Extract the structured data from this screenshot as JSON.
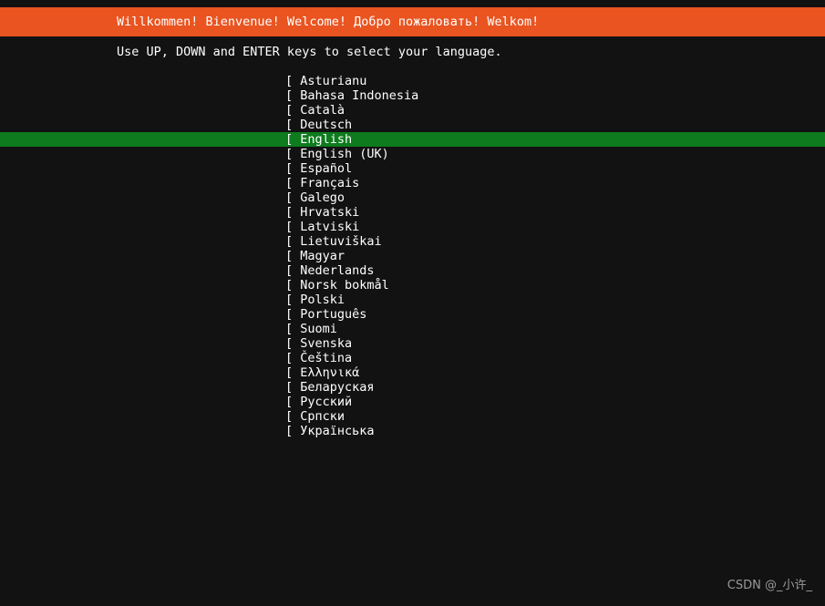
{
  "screen": {
    "background_color": "#121212",
    "accent_color": "#e95420",
    "highlight_color": "#0e7b1e",
    "text_color": "#ffffff"
  },
  "banner": {
    "text": "Willkommen! Bienvenue! Welcome! Добро пожаловать! Welkom!"
  },
  "instruction": {
    "text": "Use UP, DOWN and ENTER keys to select your language."
  },
  "language_list": {
    "bracket_prefix": "[ ",
    "selected_index": 4,
    "items": [
      {
        "label": "Asturianu",
        "selected": false
      },
      {
        "label": "Bahasa Indonesia",
        "selected": false
      },
      {
        "label": "Català",
        "selected": false
      },
      {
        "label": "Deutsch",
        "selected": false
      },
      {
        "label": "English",
        "selected": true
      },
      {
        "label": "English (UK)",
        "selected": false
      },
      {
        "label": "Español",
        "selected": false
      },
      {
        "label": "Français",
        "selected": false
      },
      {
        "label": "Galego",
        "selected": false
      },
      {
        "label": "Hrvatski",
        "selected": false
      },
      {
        "label": "Latviski",
        "selected": false
      },
      {
        "label": "Lietuviškai",
        "selected": false
      },
      {
        "label": "Magyar",
        "selected": false
      },
      {
        "label": "Nederlands",
        "selected": false
      },
      {
        "label": "Norsk bokmål",
        "selected": false
      },
      {
        "label": "Polski",
        "selected": false
      },
      {
        "label": "Português",
        "selected": false
      },
      {
        "label": "Suomi",
        "selected": false
      },
      {
        "label": "Svenska",
        "selected": false
      },
      {
        "label": "Čeština",
        "selected": false
      },
      {
        "label": "Ελληνικά",
        "selected": false
      },
      {
        "label": "Беларуская",
        "selected": false
      },
      {
        "label": "Русский",
        "selected": false
      },
      {
        "label": "Српски",
        "selected": false
      },
      {
        "label": "Українська",
        "selected": false
      }
    ]
  },
  "watermark": {
    "text": "CSDN @_小许_"
  }
}
